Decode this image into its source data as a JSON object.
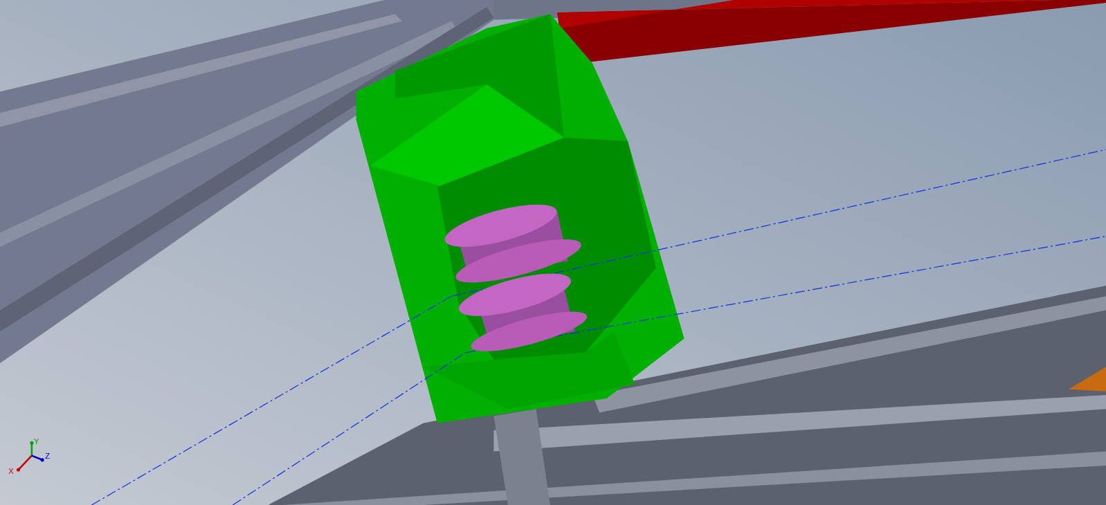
{
  "view_triad": {
    "axes": [
      {
        "label": "X",
        "color": "#c00000"
      },
      {
        "label": "Y",
        "color": "#00a000"
      },
      {
        "label": "Z",
        "color": "#0000c0"
      }
    ]
  }
}
